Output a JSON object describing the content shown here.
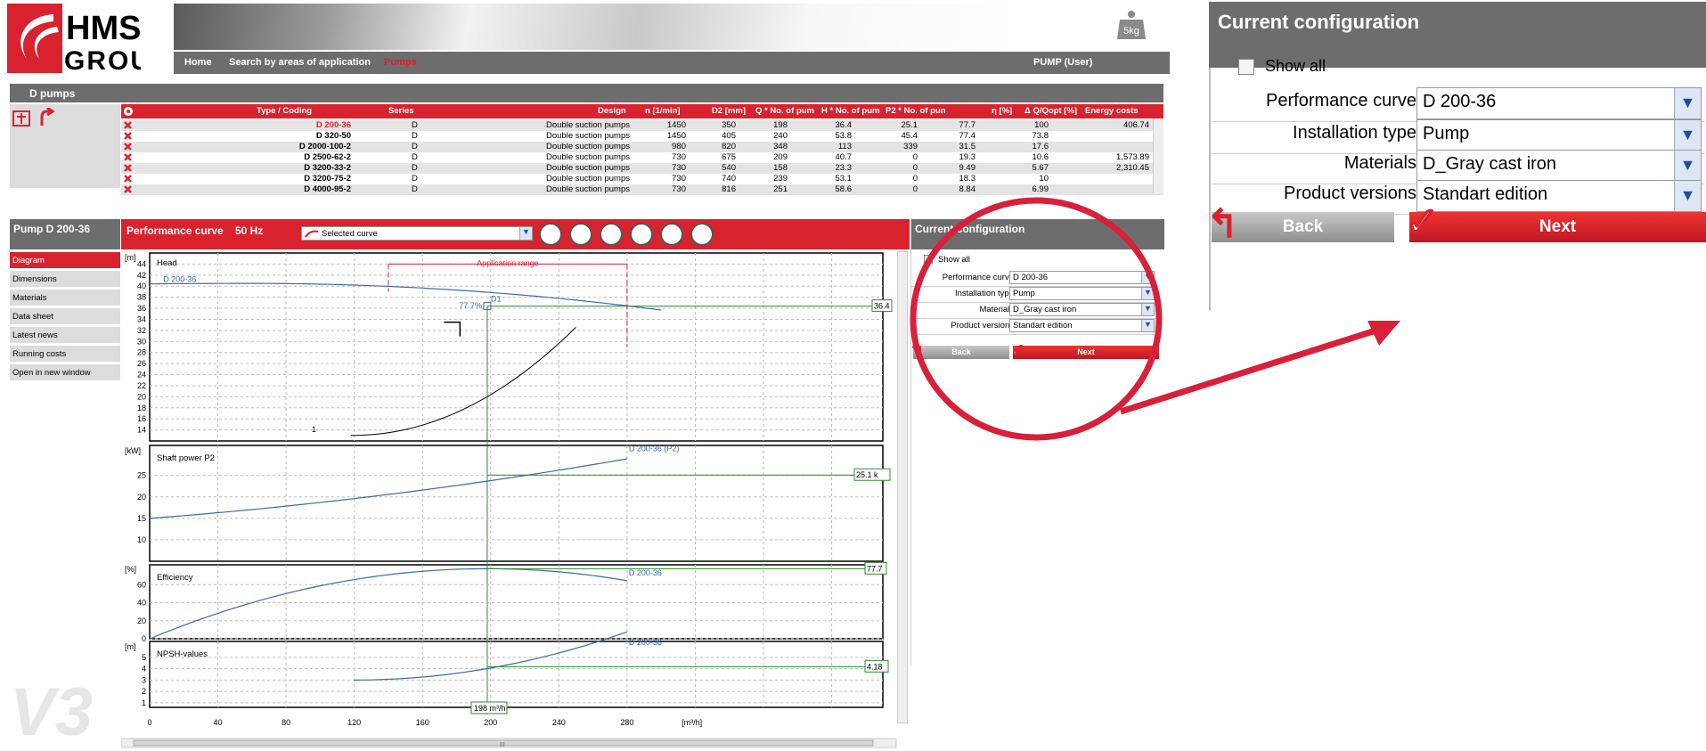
{
  "header": {
    "logo_line1": "HMS",
    "logo_line2": "GROUP",
    "nav": [
      "Home",
      "Search by areas of application",
      "Pumps"
    ],
    "user": "PUMP (User)",
    "weight_label": "5kg"
  },
  "section_title": "D pumps",
  "table": {
    "columns": [
      "Type / Coding",
      "Series",
      "Design",
      "n [1/min]",
      "D2 [mm]",
      "Q * No. of pum",
      "H * No. of pum",
      "P2 * No. of pun",
      "η [%]",
      "Δ Q/Qopt [%]",
      "Energy costs"
    ],
    "rows": [
      [
        "D 200-36",
        "D",
        "Double suction pumps",
        "1450",
        "350",
        "198",
        "36.4",
        "25.1",
        "77.7",
        "100",
        "406.74"
      ],
      [
        "D 320-50",
        "D",
        "Double suction pumps",
        "1450",
        "405",
        "240",
        "53.8",
        "45.4",
        "77.4",
        "73.8",
        ""
      ],
      [
        "D 2000-100-2",
        "D",
        "Double suction pumps",
        "980",
        "820",
        "348",
        "113",
        "339",
        "31.5",
        "17.6",
        ""
      ],
      [
        "D 2500-62-2",
        "D",
        "Double suction pumps",
        "730",
        "675",
        "209",
        "40.7",
        "0",
        "19.3",
        "10.6",
        "1,573.89"
      ],
      [
        "D 3200-33-2",
        "D",
        "Double suction pumps",
        "730",
        "540",
        "158",
        "23.3",
        "0",
        "9.49",
        "5.67",
        "2,310.45"
      ],
      [
        "D 3200-75-2",
        "D",
        "Double suction pumps",
        "730",
        "740",
        "239",
        "53.1",
        "0",
        "18.3",
        "10",
        ""
      ],
      [
        "D 4000-95-2",
        "D",
        "Double suction pumps",
        "730",
        "816",
        "251",
        "58.6",
        "0",
        "8.84",
        "6.99",
        ""
      ]
    ]
  },
  "pump_title": "Pump D 200-36",
  "left_nav": [
    "Diagram",
    "Dimensions",
    "Materials",
    "Data sheet",
    "Latest news",
    "Running costs",
    "Open in new window"
  ],
  "perf": {
    "title": "Performance curve",
    "freq": "50 Hz",
    "select_value": "Selected curve",
    "tool_icons": [
      "stack-icon",
      "curve-icon",
      "water-icon",
      "diameter-icon",
      "gauge-icon",
      "thermometer-icon"
    ]
  },
  "diagram": {
    "head_label": "Head",
    "head_unit": "[m]",
    "head_curve_label": "D 200-36",
    "app_range_label": "Application range",
    "op_label": "D1",
    "eff_at_op": "77.7%",
    "head_value_box": "36.4",
    "system_curve_label": "1",
    "p2_label": "Shaft power P2",
    "p2_unit": "[kW]",
    "p2_curve_label": "D 200-36 (P2)",
    "p2_value_box": "25.1 k",
    "eff_label": "Efficiency",
    "eff_unit": "[%]",
    "eff_curve_label": "D 200-36",
    "eff_value_box": "77.7",
    "npsh_label": "NPSH-values",
    "npsh_unit": "[m]",
    "npsh_curve_label": "D 200-36",
    "npsh_value_box": "4.18",
    "flow_box": "198 m³/h",
    "x_unit": "[m³/h]",
    "x_ticks": [
      "0",
      "40",
      "80",
      "120",
      "160",
      "200",
      "240",
      "280"
    ],
    "head_ticks": [
      "44",
      "42",
      "40",
      "38",
      "36",
      "34",
      "32",
      "30",
      "28",
      "26",
      "24",
      "22",
      "20",
      "18",
      "16",
      "14"
    ],
    "p2_ticks": [
      "25",
      "20",
      "15",
      "10"
    ],
    "eff_ticks": [
      "60",
      "40",
      "20",
      "0"
    ],
    "npsh_ticks": [
      "5",
      "4",
      "3",
      "2",
      "1"
    ],
    "scroll_thumb": "III"
  },
  "config": {
    "title": "Current configuration",
    "show_all": "Show all",
    "fields": [
      {
        "label": "Performance curve",
        "value": "D 200-36"
      },
      {
        "label": "Installation type",
        "value": "Pump"
      },
      {
        "label": "Materials",
        "value": "D_Gray cast iron"
      },
      {
        "label": "Product versions",
        "value": "Standart edition"
      }
    ],
    "back": "Back",
    "next": "Next"
  },
  "colors": {
    "brand_red": "#d8232f",
    "bar_gray": "#6d6d6d",
    "curve_blue": "#3a6aa8",
    "op_green": "#2e8b2e",
    "highlight_red": "#d8203a"
  }
}
